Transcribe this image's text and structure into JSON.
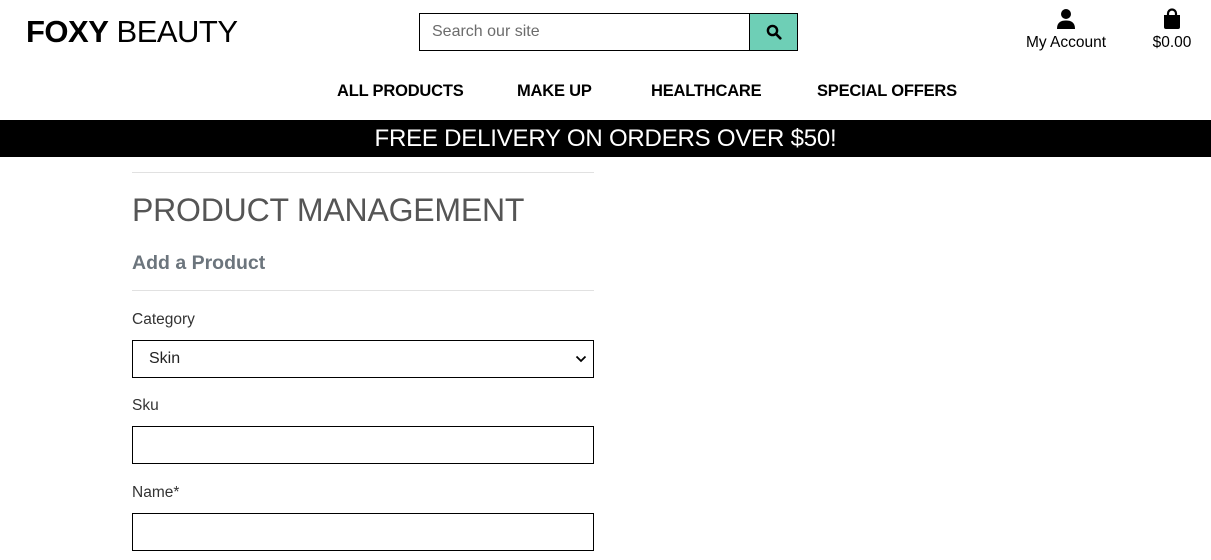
{
  "brand": {
    "bold": "FOXY",
    "light": " BEAUTY"
  },
  "search": {
    "placeholder": "Search our site",
    "icon": "search-icon"
  },
  "account": {
    "label": "My Account",
    "icon": "user-icon"
  },
  "bag": {
    "total": "$0.00",
    "icon": "shopping-bag-icon"
  },
  "nav": [
    {
      "label": "ALL PRODUCTS"
    },
    {
      "label": "MAKE UP"
    },
    {
      "label": "HEALTHCARE"
    },
    {
      "label": "SPECIAL OFFERS"
    }
  ],
  "banner": {
    "text": "FREE DELIVERY ON ORDERS OVER $50!"
  },
  "page": {
    "title": "PRODUCT MANAGEMENT",
    "subtitle": "Add a Product"
  },
  "form": {
    "category": {
      "label": "Category",
      "value": "Skin"
    },
    "sku": {
      "label": "Sku",
      "value": ""
    },
    "name": {
      "label": "Name*",
      "value": ""
    }
  },
  "colors": {
    "accent": "#6ecfb6",
    "banner_bg": "#000000",
    "banner_text": "#ffffff"
  }
}
